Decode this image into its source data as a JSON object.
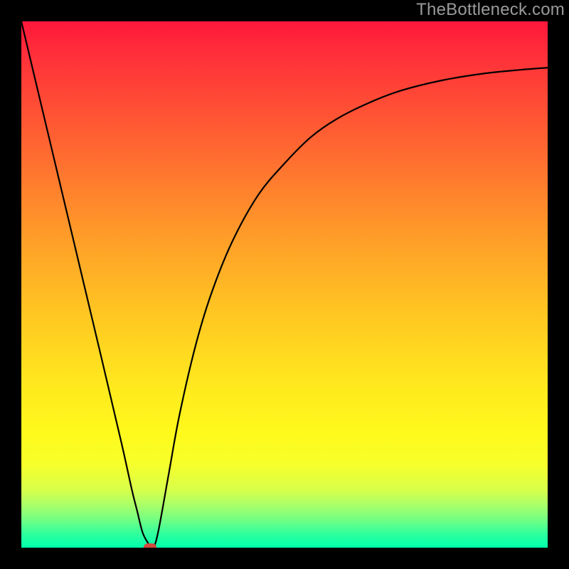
{
  "watermark": "TheBottleneck.com",
  "colors": {
    "page_bg": "#000000",
    "curve_stroke": "#000000",
    "dot_fill": "#d24a3e",
    "watermark_text": "#9a9a9a"
  },
  "chart_data": {
    "type": "line",
    "title": "",
    "xlabel": "",
    "ylabel": "",
    "xlim": [
      0,
      100
    ],
    "ylim": [
      0,
      100
    ],
    "grid": false,
    "legend": false,
    "background_gradient_vertical_stops": [
      {
        "pos": 0,
        "color": "#ff173b"
      },
      {
        "pos": 6,
        "color": "#ff2e3a"
      },
      {
        "pos": 18,
        "color": "#ff5434"
      },
      {
        "pos": 30,
        "color": "#ff7a2e"
      },
      {
        "pos": 42,
        "color": "#ffa028"
      },
      {
        "pos": 55,
        "color": "#ffc522"
      },
      {
        "pos": 68,
        "color": "#ffe61e"
      },
      {
        "pos": 78,
        "color": "#fff91c"
      },
      {
        "pos": 84,
        "color": "#f7ff2a"
      },
      {
        "pos": 89,
        "color": "#d8ff4a"
      },
      {
        "pos": 92,
        "color": "#a8ff6a"
      },
      {
        "pos": 95,
        "color": "#6cff86"
      },
      {
        "pos": 97.5,
        "color": "#2cff9e"
      },
      {
        "pos": 100,
        "color": "#00ffad"
      }
    ],
    "series": [
      {
        "name": "curve",
        "x": [
          0,
          5,
          10,
          15,
          19,
          21,
          22,
          23,
          24,
          25,
          26,
          28,
          30,
          33,
          36,
          40,
          45,
          50,
          55,
          60,
          66,
          72,
          80,
          88,
          95,
          100
        ],
        "y": [
          100,
          79,
          58,
          37,
          20,
          11,
          7,
          3,
          1,
          0,
          3,
          14,
          25,
          38,
          48,
          58,
          67,
          73,
          78,
          81.5,
          84.5,
          86.8,
          88.8,
          90.1,
          90.8,
          91.2
        ]
      }
    ],
    "marker": {
      "x": 24.5,
      "y": 0
    }
  }
}
